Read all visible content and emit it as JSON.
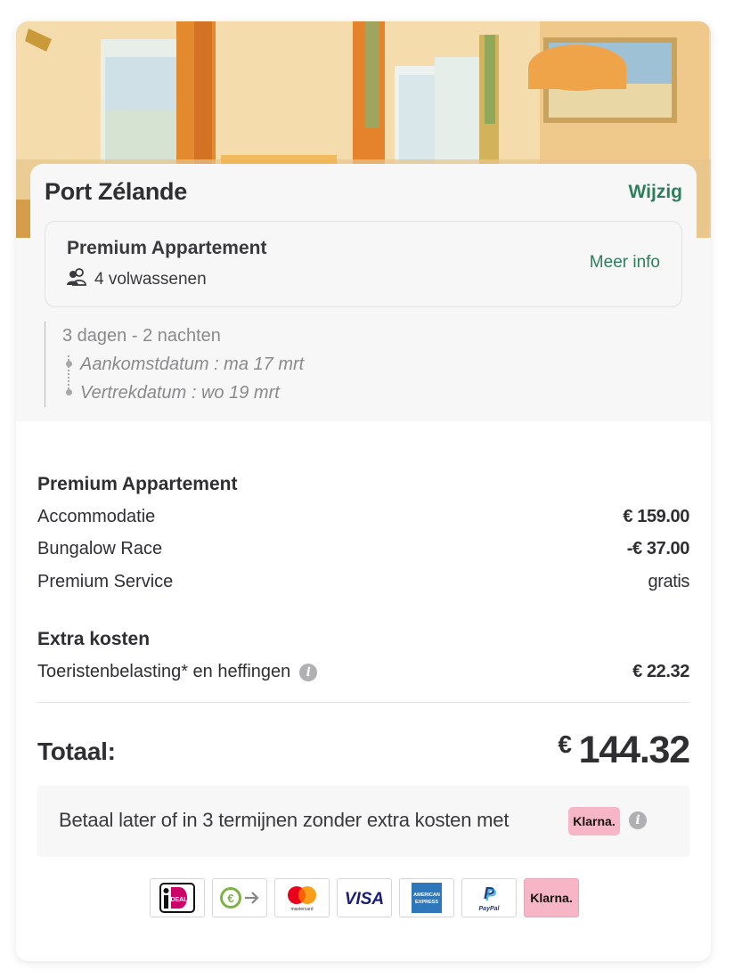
{
  "park": {
    "name": "Port Zélande",
    "change_label": "Wijzig"
  },
  "accommodation": {
    "title": "Premium Appartement",
    "guests_icon": "guests-icon",
    "guests": "4 volwassenen",
    "more_info_label": "Meer info"
  },
  "stay": {
    "duration": "3 dagen - 2 nachten",
    "arrival": "Aankomstdatum : ma 17 mrt",
    "departure": "Vertrekdatum : wo 19 mrt"
  },
  "pricing": {
    "section1_title": "Premium Appartement",
    "lines": [
      {
        "label": "Accommodatie",
        "value": "€ 159.00"
      },
      {
        "label": "Bungalow Race",
        "value": "-€ 37.00"
      },
      {
        "label": "Premium Service",
        "value": "gratis"
      }
    ],
    "section2_title": "Extra kosten",
    "extra_lines": [
      {
        "label": "Toeristenbelasting* en heffingen",
        "value": "€ 22.32",
        "icon": "info-icon"
      }
    ],
    "total_label": "Totaal:",
    "total_currency": "€",
    "total_amount": "144.32"
  },
  "klarna": {
    "message": "Betaal later of in 3 termijnen zonder extra kosten met",
    "badge": "Klarna.",
    "icon": "info-icon"
  },
  "payment_methods": [
    {
      "name": "iDEAL",
      "icon": "ideal-icon",
      "label": "iDEAL"
    },
    {
      "name": "Bank transfer",
      "icon": "bank-transfer-icon"
    },
    {
      "name": "Mastercard",
      "icon": "mastercard-icon",
      "label": "mastercard"
    },
    {
      "name": "Visa",
      "icon": "visa-icon",
      "label": "VISA"
    },
    {
      "name": "American Express",
      "icon": "amex-icon",
      "label": "AMERICAN EXPRESS"
    },
    {
      "name": "PayPal",
      "icon": "paypal-icon",
      "label": "PayPal"
    },
    {
      "name": "Klarna",
      "icon": "klarna-icon",
      "label": "Klarna."
    }
  ],
  "colors": {
    "accent_green": "#2e7d5b",
    "text": "#2f2f33",
    "muted": "#8a8a8c",
    "panel": "#f6f7f6",
    "klarna_pink": "#f7b6c8"
  }
}
